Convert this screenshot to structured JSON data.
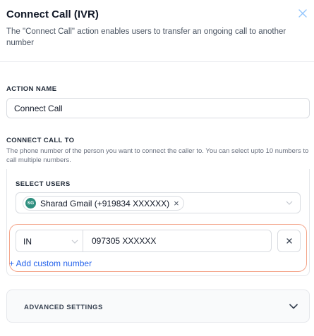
{
  "header": {
    "title": "Connect Call (IVR)",
    "description": "The \"Connect Call\" action enables users to transfer an ongoing call to another number",
    "close_icon": "close-icon"
  },
  "action_name": {
    "label": "ACTION NAME",
    "value": "Connect Call"
  },
  "connect_call_to": {
    "label": "CONNECT CALL TO",
    "help": "The phone number of the person you want to connect the caller to. You can select upto 10 numbers to call multiple numbers.",
    "select_users": {
      "label": "SELECT USERS",
      "selected": [
        {
          "initials": "SG",
          "label": "Sharad Gmail (+919834 XXXXXX)"
        }
      ],
      "chevron_icon": "chevron-down-icon"
    },
    "custom_number": {
      "country": "IN",
      "number": "097305 XXXXXX",
      "remove_icon": "close-icon"
    },
    "add_custom_number": "+ Add custom number"
  },
  "advanced_settings": {
    "label": "ADVANCED SETTINGS",
    "chevron_icon": "chevron-down-icon"
  },
  "colors": {
    "accent_link": "#2563eb",
    "highlight_border": "#f4a58a",
    "avatar": "#2f8f7f"
  }
}
